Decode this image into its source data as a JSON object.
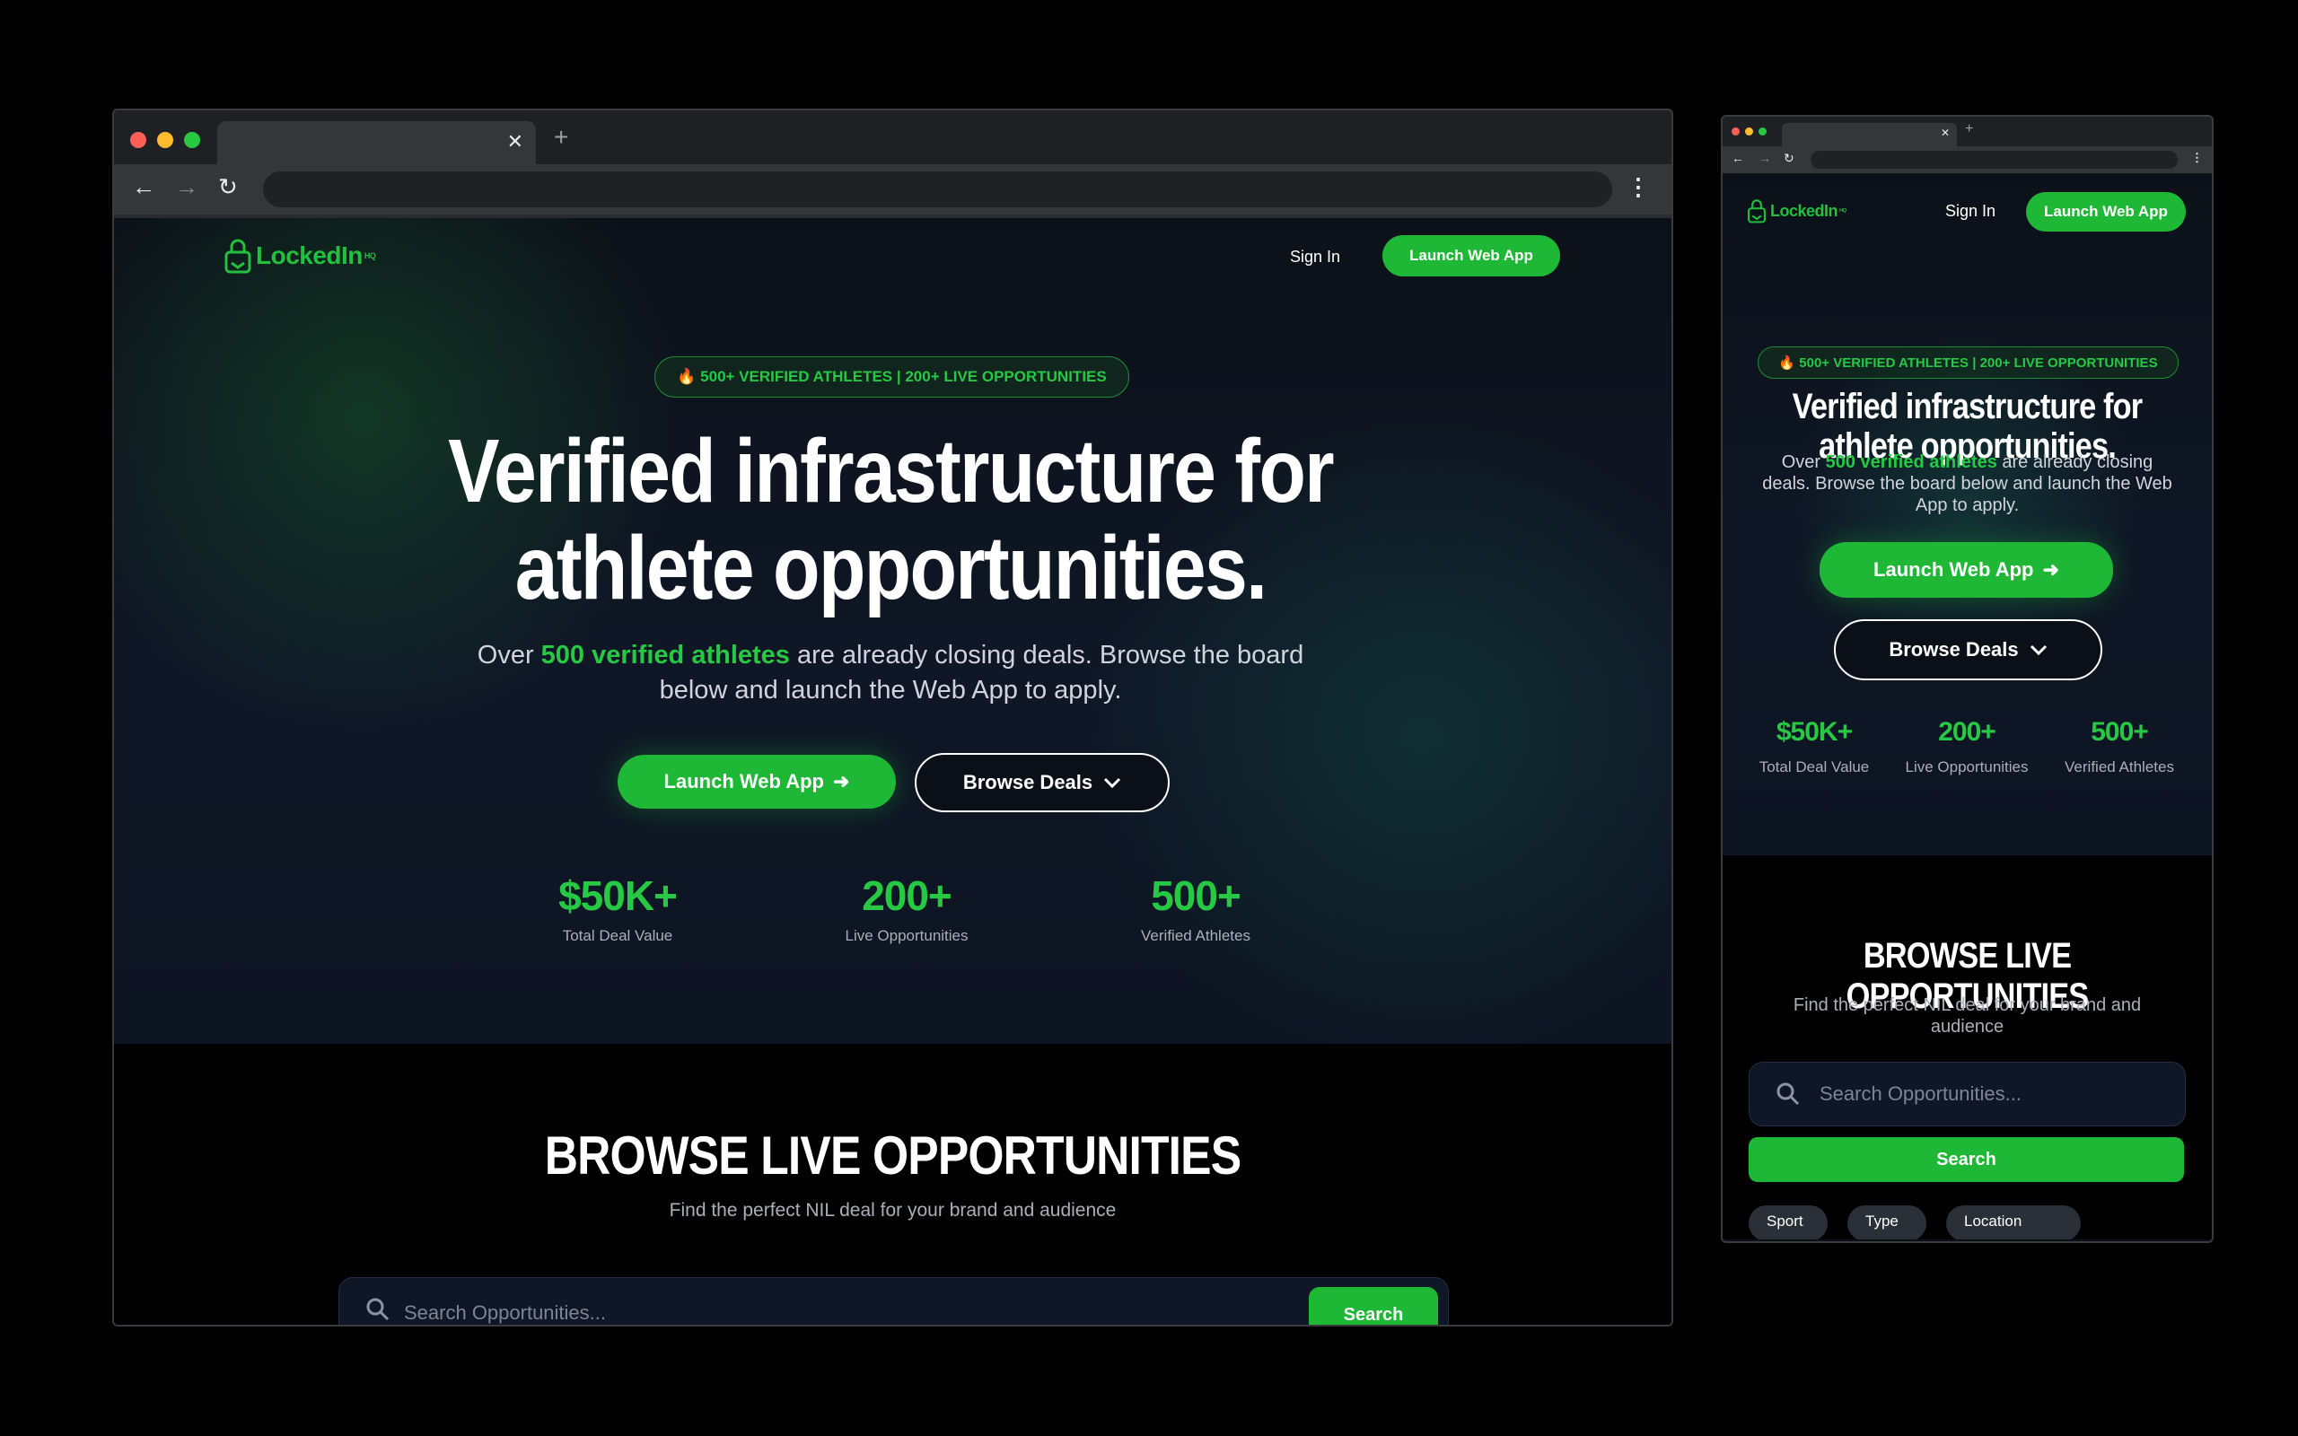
{
  "brand": {
    "name": "LockedIn",
    "mark": "HQ",
    "accent": "#1eb836",
    "background": "#0b0f17"
  },
  "browser_chrome": {
    "close_glyph": "✕",
    "new_tab_glyph": "+",
    "back_glyph": "←",
    "forward_glyph": "→",
    "reload_glyph": "↻",
    "menu_glyph": "⋮"
  },
  "nav": {
    "sign_in": "Sign In",
    "cta": "Launch Web App"
  },
  "hero": {
    "badge": "🔥 500+ VERIFIED ATHLETES | 200+ LIVE OPPORTUNITIES",
    "headline_line1": "Verified infrastructure for",
    "headline_line2": "athlete opportunities.",
    "sub_prefix": "Over ",
    "sub_highlight": "500 verified athletes",
    "sub_suffix": " are already closing deals. Browse the board below and launch the Web App to apply.",
    "primary_cta": "Launch Web App",
    "primary_cta_icon": "arrow-right-icon",
    "secondary_cta": "Browse Deals",
    "secondary_cta_icon": "chevron-down-icon"
  },
  "stats": [
    {
      "value": "$50K+",
      "label": "Total Deal Value"
    },
    {
      "value": "200+",
      "label": "Live Opportunities"
    },
    {
      "value": "500+",
      "label": "Verified Athletes"
    }
  ],
  "browse": {
    "title": "BROWSE LIVE OPPORTUNITIES",
    "subtitle": "Find the perfect NIL deal for your brand and audience",
    "search_placeholder": "Search Opportunities...",
    "search_button": "Search"
  },
  "filters": [
    "Sport",
    "Type",
    "Location"
  ]
}
